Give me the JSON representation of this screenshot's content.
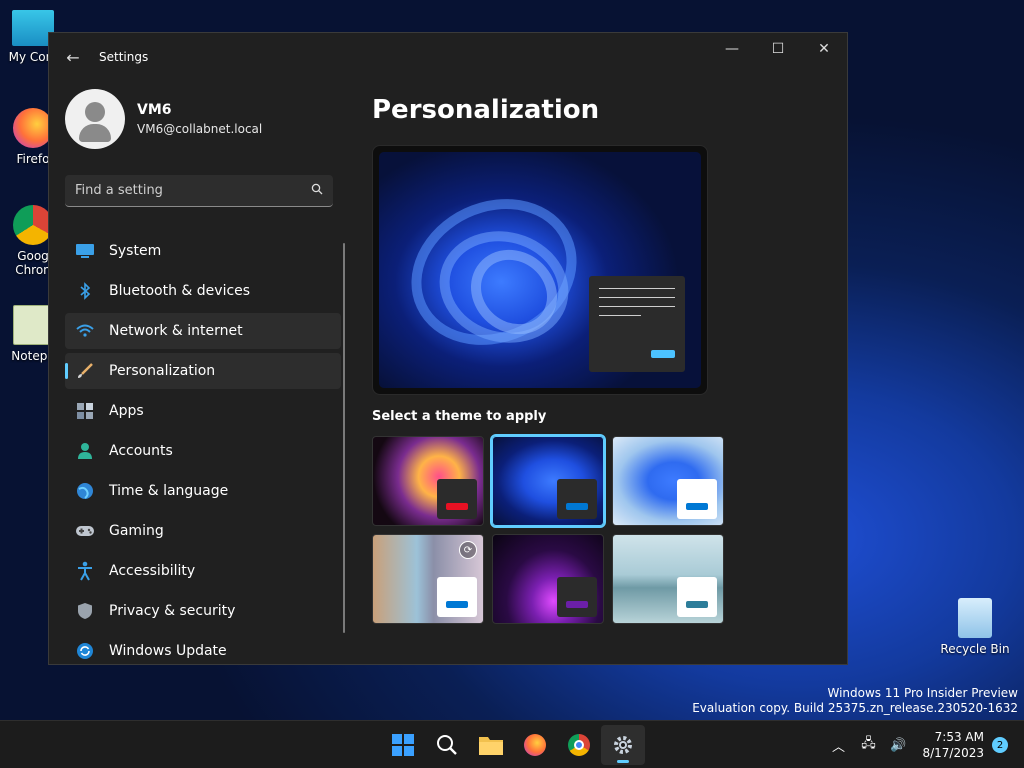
{
  "desktop": {
    "icons": [
      {
        "label": "My Com"
      },
      {
        "label": "Firefo"
      },
      {
        "label": "Goog",
        "label2": "Chron"
      },
      {
        "label": "Notepa"
      },
      {
        "label": "Recycle Bin"
      }
    ],
    "watermark": {
      "line1": "Windows 11 Pro Insider Preview",
      "line2": "Evaluation copy. Build 25375.zn_release.230520-1632"
    }
  },
  "window": {
    "title": "Settings",
    "back_icon": "back-arrow-icon",
    "controls": {
      "minimize": "—",
      "maximize": "☐",
      "close": "✕"
    }
  },
  "profile": {
    "name": "VM6",
    "email": "VM6@collabnet.local"
  },
  "search": {
    "placeholder": "Find a setting",
    "value": ""
  },
  "nav": {
    "items": [
      {
        "label": "System",
        "icon": "system-icon"
      },
      {
        "label": "Bluetooth & devices",
        "icon": "bluetooth-icon"
      },
      {
        "label": "Network & internet",
        "icon": "wifi-icon"
      },
      {
        "label": "Personalization",
        "icon": "brush-icon",
        "selected": true
      },
      {
        "label": "Apps",
        "icon": "apps-icon"
      },
      {
        "label": "Accounts",
        "icon": "accounts-icon"
      },
      {
        "label": "Time & language",
        "icon": "globe-icon"
      },
      {
        "label": "Gaming",
        "icon": "gamepad-icon"
      },
      {
        "label": "Accessibility",
        "icon": "accessibility-icon"
      },
      {
        "label": "Privacy & security",
        "icon": "shield-icon"
      },
      {
        "label": "Windows Update",
        "icon": "update-icon"
      }
    ]
  },
  "content": {
    "title": "Personalization",
    "themes_label": "Select a theme to apply",
    "themes": [
      {
        "name": "theme-flower",
        "accent": "#e81123"
      },
      {
        "name": "theme-windows-dark",
        "accent": "#0078d4",
        "selected": true
      },
      {
        "name": "theme-windows-light",
        "accent": "#0078d4"
      },
      {
        "name": "theme-captured-motion",
        "accent": "#0078d4"
      },
      {
        "name": "theme-glow",
        "accent": "#6b1fa8"
      },
      {
        "name": "theme-sunrise",
        "accent": "#2d7d9a"
      }
    ]
  },
  "taskbar": {
    "time": "7:53 AM",
    "date": "8/17/2023",
    "notifications": "2"
  },
  "colors": {
    "accent": "#60cdff",
    "window_bg": "#202020",
    "nav_selected_bg": "#2d2d2d"
  }
}
